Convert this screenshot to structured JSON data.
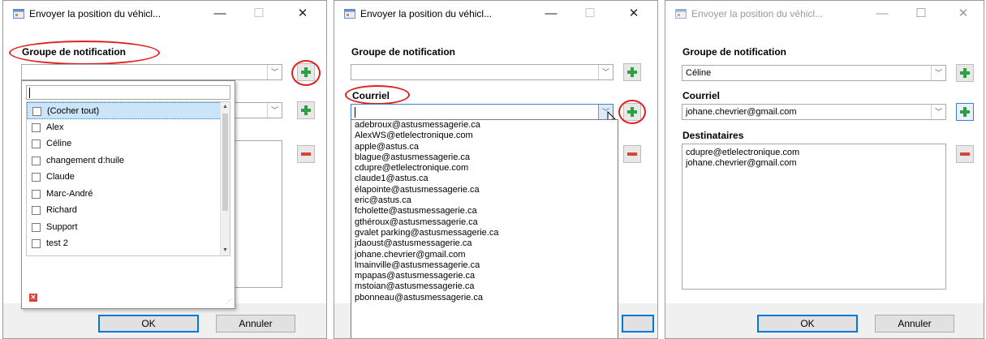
{
  "windows": [
    {
      "title": "Envoyer la position du véhicl...",
      "notif_label": "Groupe de notification",
      "notif_value": "",
      "dropdown": {
        "search_value": "",
        "items": [
          "(Cocher tout)",
          "Alex",
          "Céline",
          "changement d:huile",
          "Claude",
          "Marc-André",
          "Richard",
          "Support",
          "test 2"
        ]
      },
      "ok": "OK",
      "cancel": "Annuler"
    },
    {
      "title": "Envoyer la position du véhicl...",
      "notif_label": "Groupe de notification",
      "notif_value": "",
      "courriel_label": "Courriel",
      "courriel_value": "",
      "emails": [
        "adebroux@astusmessagerie.ca",
        "AlexWS@etlelectronique.com",
        "apple@astus.ca",
        "blague@astusmessagerie.ca",
        "cdupre@etlelectronique.com",
        "claude1@astus.ca",
        "élapointe@astusmessagerie.ca",
        "eric@astus.ca",
        "fcholette@astusmessagerie.ca",
        "gthéroux@astusmessagerie.ca",
        "gvalet parking@astusmessagerie.ca",
        "jdaoust@astusmessagerie.ca",
        "johane.chevrier@gmail.com",
        "lmainville@astusmessagerie.ca",
        "mpapas@astusmessagerie.ca",
        "mstoian@astusmessagerie.ca",
        "pbonneau@astusmessagerie.ca"
      ]
    },
    {
      "title": "Envoyer la position du véhicl...",
      "notif_label": "Groupe de notification",
      "notif_value": "Céline",
      "courriel_label": "Courriel",
      "courriel_value": "johane.chevrier@gmail.com",
      "dest_label": "Destinataires",
      "recipients": [
        "cdupre@etlelectronique.com",
        "johane.chevrier@gmail.com"
      ],
      "ok": "OK",
      "cancel": "Annuler"
    }
  ],
  "icons": {
    "app": "app-window-icon",
    "minimize": "—",
    "maximize": "☐",
    "close": "✕",
    "dropdown_arrow": "﹀"
  },
  "colors": {
    "add_green": "#2ea043",
    "remove_red": "#d9443a",
    "annotation_red": "#e02020",
    "focus_blue": "#3c7fd0"
  }
}
